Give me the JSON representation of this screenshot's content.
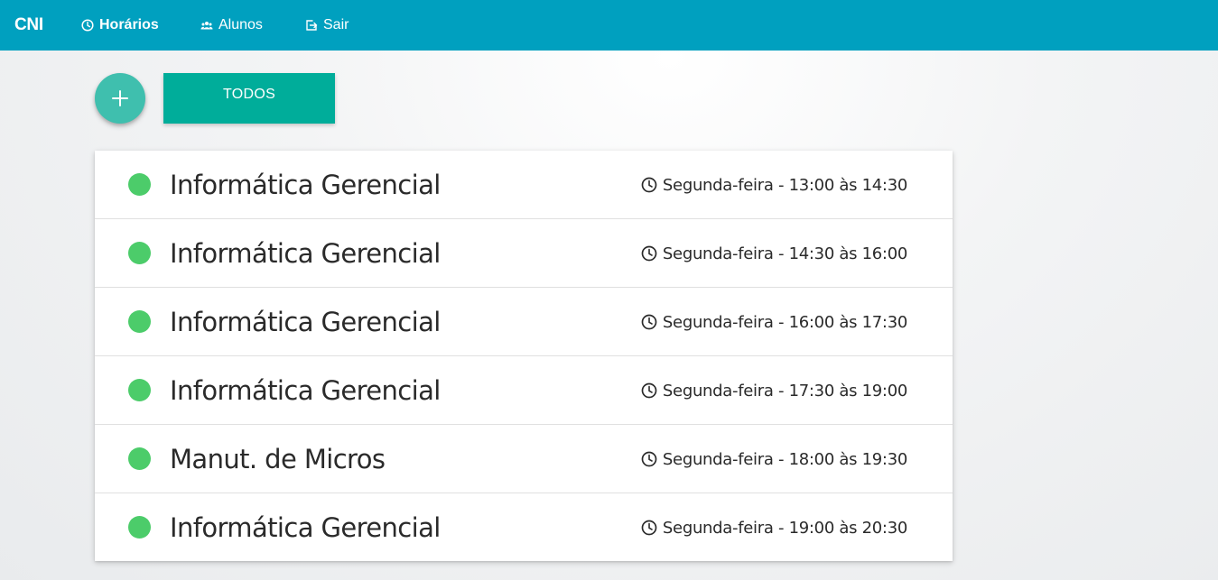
{
  "navbar": {
    "brand": "CNI",
    "items": [
      {
        "label": "Horários",
        "icon": "clock-icon",
        "active": true
      },
      {
        "label": "Alunos",
        "icon": "people-icon",
        "active": false
      },
      {
        "label": "Sair",
        "icon": "exit-icon",
        "active": false
      }
    ]
  },
  "toolbar": {
    "add_label": "+",
    "filter_label": "TODOS"
  },
  "colors": {
    "navbar": "#00a0bf",
    "fab": "#3fbfae",
    "filter_button": "#00ad9a",
    "status_dot": "#4ccc6a"
  },
  "schedule": [
    {
      "subject": "Informática Gerencial",
      "time": "Segunda-feira - 13:00 às 14:30",
      "status": "active"
    },
    {
      "subject": "Informática Gerencial",
      "time": "Segunda-feira - 14:30 às 16:00",
      "status": "active"
    },
    {
      "subject": "Informática Gerencial",
      "time": "Segunda-feira - 16:00 às 17:30",
      "status": "active"
    },
    {
      "subject": "Informática Gerencial",
      "time": "Segunda-feira - 17:30 às 19:00",
      "status": "active"
    },
    {
      "subject": "Manut. de Micros",
      "time": "Segunda-feira - 18:00 às 19:30",
      "status": "active"
    },
    {
      "subject": "Informática Gerencial",
      "time": "Segunda-feira - 19:00 às 20:30",
      "status": "active"
    }
  ]
}
